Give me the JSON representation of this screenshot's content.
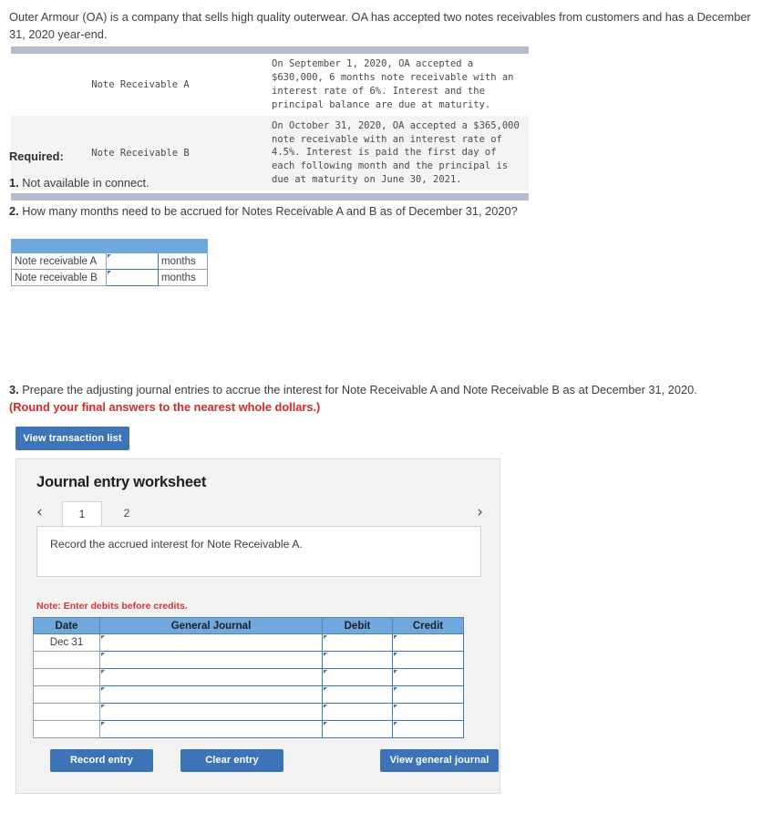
{
  "intro": {
    "text": "Outer Armour (OA) is a company that sells high quality outerwear. OA has accepted two notes receivables from customers and has a December 31, 2020 year-end."
  },
  "info_table": {
    "rows": [
      {
        "label": "Note Receivable A",
        "description": "On September 1, 2020, OA accepted a $630,000, 6 months note receivable with an interest rate of 6%. Interest and the principal balance are due at maturity."
      },
      {
        "label": "Note Receivable B",
        "description": "On October 31, 2020, OA accepted a $365,000 note receivable with an interest rate of 4.5%. Interest is paid the first day of each following month and the principal is due at maturity on June 30, 2021."
      }
    ]
  },
  "required": {
    "heading": "Required:",
    "q1_num": "1.",
    "q1_text": " Not available in connect.",
    "q2_num": "2.",
    "q2_text": " How many months need to be accrued for Notes Receivable A and B as of December 31, 2020?",
    "q3_num": "3.",
    "q3_text": " Prepare the adjusting journal entries to accrue the interest for Note Receivable A and Note Receivable B as at December 31, 2020.",
    "q3_round": "(Round your final answers to the nearest whole dollars.)"
  },
  "months_table": {
    "rows": [
      {
        "label": "Note receivable A",
        "value": "",
        "unit": "months"
      },
      {
        "label": "Note receivable B",
        "value": "",
        "unit": "months"
      }
    ]
  },
  "buttons": {
    "view_transaction_list": "View transaction list",
    "record_entry": "Record entry",
    "clear_entry": "Clear entry",
    "view_general_journal": "View general journal"
  },
  "worksheet": {
    "title": "Journal entry worksheet",
    "tabs": [
      {
        "label": "1",
        "active": true
      },
      {
        "label": "2",
        "active": false
      }
    ],
    "prev_icon": "‹",
    "next_icon": "›",
    "instruction": "Record the accrued interest for Note Receivable A.",
    "note": "Note: Enter debits before credits.",
    "table": {
      "headers": [
        "Date",
        "General Journal",
        "Debit",
        "Credit"
      ],
      "rows": [
        {
          "date": "Dec 31",
          "general_journal": "",
          "debit": "",
          "credit": ""
        },
        {
          "date": "",
          "general_journal": "",
          "debit": "",
          "credit": ""
        },
        {
          "date": "",
          "general_journal": "",
          "debit": "",
          "credit": ""
        },
        {
          "date": "",
          "general_journal": "",
          "debit": "",
          "credit": ""
        },
        {
          "date": "",
          "general_journal": "",
          "debit": "",
          "credit": ""
        },
        {
          "date": "",
          "general_journal": "",
          "debit": "",
          "credit": ""
        }
      ]
    }
  },
  "colors": {
    "accent_blue": "#3d74b8",
    "table_header_blue": "#6fa8dc",
    "info_band_grey": "#b4bcd0",
    "warning_red": "#d22a2a",
    "note_red": "#cf3a3a",
    "input_border": "#3c78b4"
  }
}
